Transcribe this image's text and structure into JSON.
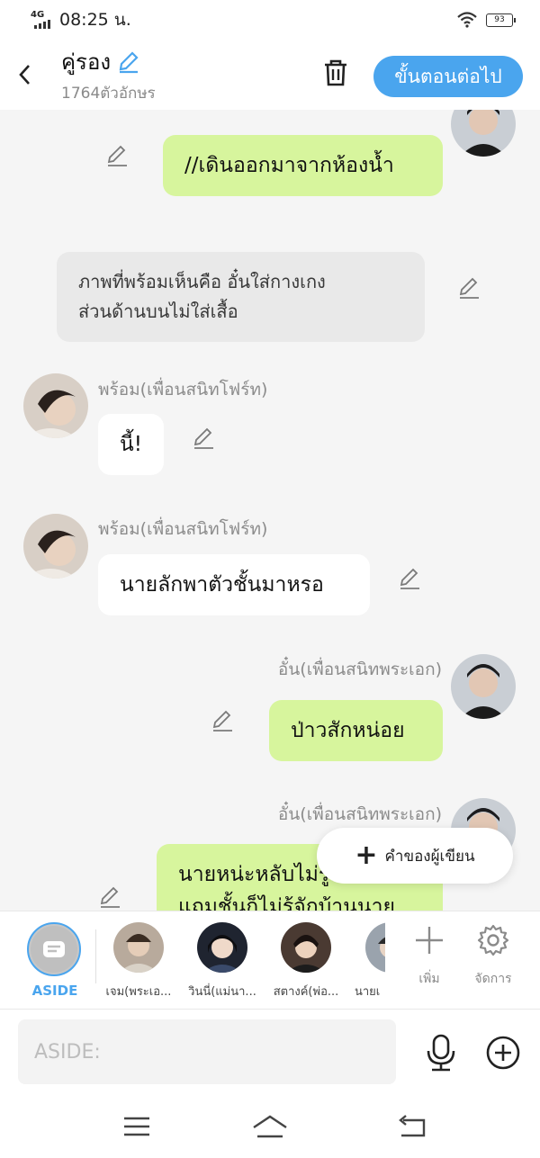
{
  "status_bar": {
    "network": "4G",
    "time": "08:25 น.",
    "battery": "93"
  },
  "header": {
    "title": "คู่รอง",
    "subtitle": "1764ตัวอักษร",
    "next_label": "ขั้นตอนต่อไป"
  },
  "messages": [
    {
      "type": "right",
      "name": "",
      "text": "//เดินออกมาจากห้องน้ำ"
    },
    {
      "type": "narration",
      "lines": [
        "ภาพที่พร้อมเห็นคือ อั๋นใส่กางเกง",
        "ส่วนด้านบนไม่ใส่เสื้อ"
      ]
    },
    {
      "type": "left",
      "name": "พร้อม(เพื่อนสนิทโฟร์ท)",
      "text": "นี้!"
    },
    {
      "type": "left",
      "name": "พร้อม(เพื่อนสนิทโฟร์ท)",
      "text": "นายลักพาตัวชั้นมาหรอ"
    },
    {
      "type": "right",
      "name": "อั๋น(เพื่อนสนิทพระเอก)",
      "text": "ป่าวสักหน่อย"
    },
    {
      "type": "right",
      "name": "อั๋น(เพื่อนสนิทพระเอก)",
      "lines": [
        "นายหน่ะหลับไม่รู้เรื่อง",
        "แถมชั้นก็ไม่รู้จักบ้านนาย"
      ]
    }
  ],
  "fab": {
    "label": "คำของผู้เขียน"
  },
  "character_bar": {
    "aside_label": "ASIDE",
    "characters": [
      {
        "label": "เจม(พระเอ...",
        "color": "#8a7a6a"
      },
      {
        "label": "วินนี่(แม่นา...",
        "color": "#2b2f3a"
      },
      {
        "label": "สตางค์(พ่อ...",
        "color": "#3a2e2a"
      },
      {
        "label": "นายเ",
        "color": "#9aa3ad"
      }
    ],
    "add_label": "เพิ่ม",
    "manage_label": "จัดการ"
  },
  "input": {
    "placeholder": "ASIDE:"
  },
  "colors": {
    "accent": "#4aa5ee",
    "green_bubble": "#d7f59d",
    "white_bubble": "#ffffff",
    "narration": "#e9e9e9"
  }
}
